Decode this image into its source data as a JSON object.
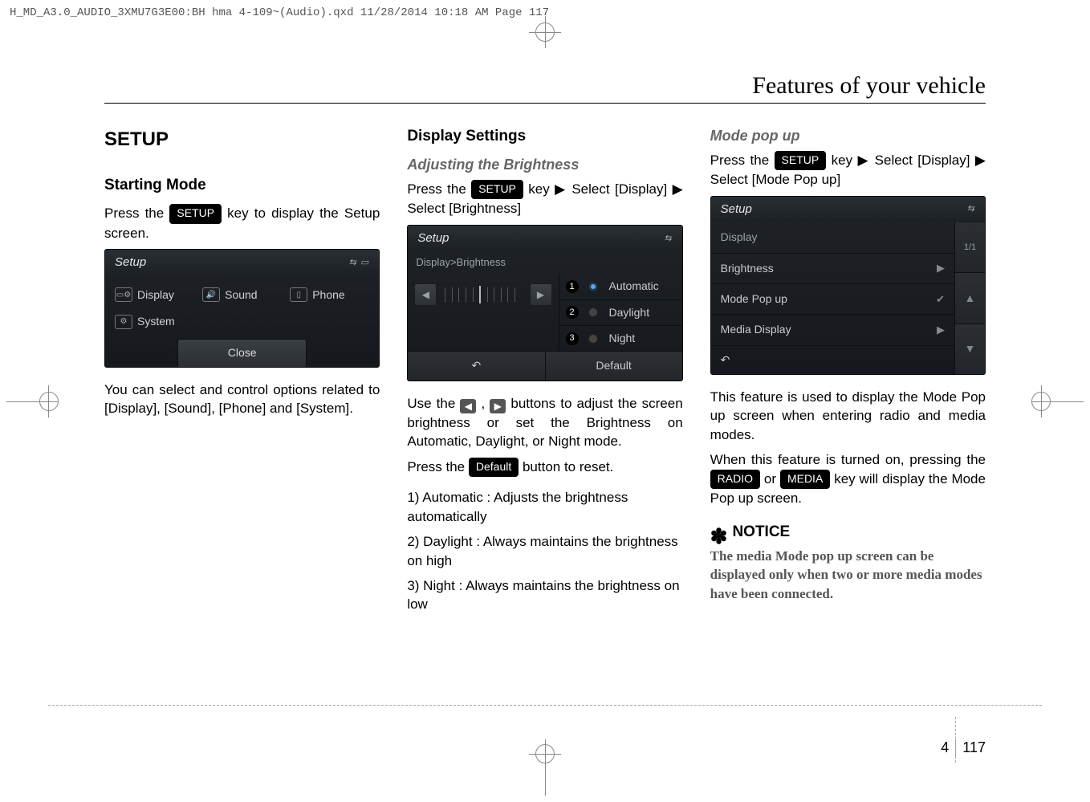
{
  "print_header": "H_MD_A3.0_AUDIO_3XMU7G3E00:BH hma 4-109~(Audio).qxd  11/28/2014  10:18 AM  Page 117",
  "section_title": "Features of your vehicle",
  "page": {
    "chapter": "4",
    "number": "117"
  },
  "col1": {
    "h2": "SETUP",
    "h3": "Starting Mode",
    "p1a": "Press the ",
    "pill1": "SETUP",
    "p1b": " key to display the Setup screen.",
    "ss": {
      "title": "Setup",
      "items": [
        {
          "icon": "display",
          "label": "Display"
        },
        {
          "icon": "sound",
          "label": "Sound"
        },
        {
          "icon": "phone",
          "label": "Phone"
        },
        {
          "icon": "system",
          "label": "System"
        }
      ],
      "close": "Close"
    },
    "p2": "You can select and control options related to [Display], [Sound], [Phone] and [System]."
  },
  "col2": {
    "h3": "Display Settings",
    "h4": "Adjusting the Brightness",
    "p1a": "Press the ",
    "pill1": "SETUP",
    "p1b": " key",
    "p1c": "Select [Display] ",
    "p1d": "Select [Brightness]",
    "ss": {
      "title": "Setup",
      "breadcrumb": "Display>Brightness",
      "options": [
        {
          "n": "1",
          "label": "Automatic",
          "selected": true
        },
        {
          "n": "2",
          "label": "Daylight",
          "selected": false
        },
        {
          "n": "3",
          "label": "Night",
          "selected": false
        }
      ],
      "default": "Default",
      "back": "↶"
    },
    "p2a": "Use the ",
    "p2b": " , ",
    "p2c": " buttons to adjust the screen brightness or set the Brightness on Automatic, Daylight, or Night mode.",
    "p3a": "Press the ",
    "pill2": "Default",
    "p3b": " button to reset.",
    "list": [
      "Automatic : Adjusts the brightness automatically",
      "Daylight : Always maintains the brightness on high",
      "Night : Always maintains the brightness on low"
    ]
  },
  "col3": {
    "h4": "Mode pop up",
    "p1a": "Press the ",
    "pill1": "SETUP",
    "p1b": " key",
    "p1c": "Select [Display] ",
    "p1d": "Select [Mode Pop up]",
    "ss": {
      "title": "Setup",
      "header_row": "Display",
      "page_ind": "1/1",
      "rows": [
        {
          "label": "Brightness",
          "icon": "chev"
        },
        {
          "label": "Mode Pop up",
          "icon": "check"
        },
        {
          "label": "Media Display",
          "icon": "chev"
        }
      ],
      "back": "↶"
    },
    "p2": "This feature is used to display the Mode Pop up screen when entering radio and media modes.",
    "p3a": "When this feature is turned on, pressing the ",
    "pill2": "RADIO",
    "p3b": " or ",
    "pill3": "MEDIA",
    "p3c": " key will display the Mode Pop up screen.",
    "notice_h": "NOTICE",
    "notice_body": "The media Mode pop up screen can be displayed only when two or more media modes have been connected."
  }
}
